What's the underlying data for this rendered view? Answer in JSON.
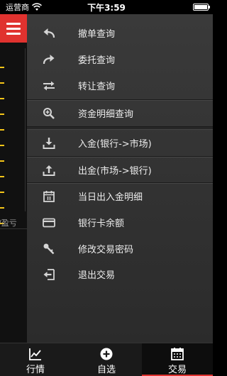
{
  "status_bar": {
    "carrier": "运营商",
    "time": "下午3:59"
  },
  "left_panel": {
    "pl_label": "/盈亏",
    "dash_color": "#f5c518",
    "dash_count": 11
  },
  "menu": {
    "items": [
      {
        "label": "撤单查询",
        "icon": "undo-arrow-icon"
      },
      {
        "label": "委托查询",
        "icon": "redo-arrow-icon"
      },
      {
        "label": "转让查询",
        "icon": "transfer-arrows-icon"
      },
      {
        "label": "资金明细查询",
        "icon": "zoom-in-icon"
      },
      {
        "label": "入金(银行->市场)",
        "icon": "download-icon"
      },
      {
        "label": "出金(市场->银行)",
        "icon": "upload-icon"
      },
      {
        "label": "当日出入金明细",
        "icon": "calendar-icon"
      },
      {
        "label": "银行卡余额",
        "icon": "card-icon"
      },
      {
        "label": "修改交易密码",
        "icon": "key-icon"
      },
      {
        "label": "退出交易",
        "icon": "logout-icon"
      }
    ]
  },
  "tabs": [
    {
      "label": "行情",
      "icon": "chart-icon",
      "active": false
    },
    {
      "label": "自选",
      "icon": "plus-circle-icon",
      "active": false
    },
    {
      "label": "交易",
      "icon": "calendar-icon",
      "active": true
    }
  ],
  "colors": {
    "accent": "#e0322f",
    "panel": "#333333"
  }
}
